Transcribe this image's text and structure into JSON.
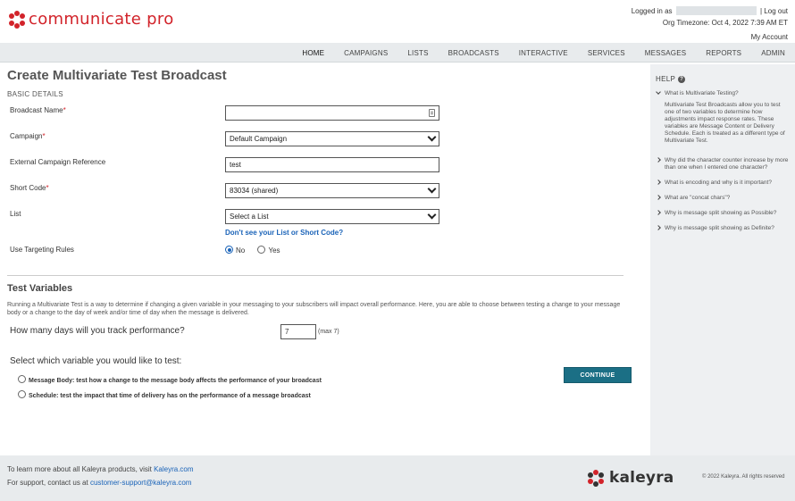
{
  "brand": {
    "logo_text": "communicate pro",
    "accent_color": "#d2232a"
  },
  "user": {
    "logged_in_as": "Logged in as",
    "logout": "| Log out",
    "timezone": "Org Timezone: Oct 4, 2022 7:39 AM ET",
    "my_account": "My Account"
  },
  "nav": {
    "items": [
      "HOME",
      "CAMPAIGNS",
      "LISTS",
      "BROADCASTS",
      "INTERACTIVE",
      "SERVICES",
      "MESSAGES",
      "REPORTS",
      "ADMIN"
    ],
    "active": "HOME"
  },
  "page": {
    "title": "Create Multivariate Test Broadcast",
    "basic_details": "BASIC DETAILS"
  },
  "form": {
    "broadcast_name": {
      "label": "Broadcast Name",
      "required": "*",
      "value": ""
    },
    "campaign": {
      "label": "Campaign",
      "required": "*",
      "value": "Default Campaign"
    },
    "external_ref": {
      "label": "External Campaign Reference",
      "value": "test"
    },
    "short_code": {
      "label": "Short Code",
      "required": "*",
      "value": "83034 (shared)"
    },
    "list": {
      "label": "List",
      "value": "Select a List",
      "help_link": "Don't see your List or Short Code?"
    },
    "targeting": {
      "label": "Use Targeting Rules",
      "options": [
        "No",
        "Yes"
      ],
      "selected": "No"
    }
  },
  "test_variables": {
    "title": "Test Variables",
    "description": "Running a Multivariate Test is a way to determine if changing a given variable in your messaging to your subscribers will impact overall performance. Here, you are able to choose between testing a change to your message body or a change to the day of week and/or time of day when the message is delivered.",
    "days_label": "How many days will you track performance?",
    "days_value": "7",
    "days_max": "(max 7)",
    "select_label": "Select which variable you would like to test:",
    "option_body": "Message Body: test how a change to the message body affects the performance of your broadcast",
    "option_schedule": "Schedule: test the impact that time of delivery has on the performance of a message broadcast"
  },
  "continue_label": "CONTINUE",
  "help": {
    "title": "HELP",
    "items": [
      {
        "q": "What is Multivariate Testing?",
        "a": "Multivariate Test Broadcasts allow you to test one of two variables to determine how adjustments impact response rates. These variables are Message Content or Delivery Schedule. Each is treated as a different type of Multivariate Test."
      },
      {
        "q": "Why did the character counter increase by more than one when I entered one character?"
      },
      {
        "q": "What is encoding and why is it important?"
      },
      {
        "q": "What are \"concat chars\"?"
      },
      {
        "q": "Why is message split showing as Possible?"
      },
      {
        "q": "Why is message split showing as Definite?"
      }
    ]
  },
  "footer": {
    "line1_prefix": "To learn more about all Kaleyra products, visit ",
    "line1_link": "Kaleyra.com",
    "line2_prefix": "For support, contact us at ",
    "line2_link": "customer-support@kaleyra.com",
    "logo_text": "kaleyra",
    "copyright": "© 2022 Kaleyra. All rights reserved"
  }
}
